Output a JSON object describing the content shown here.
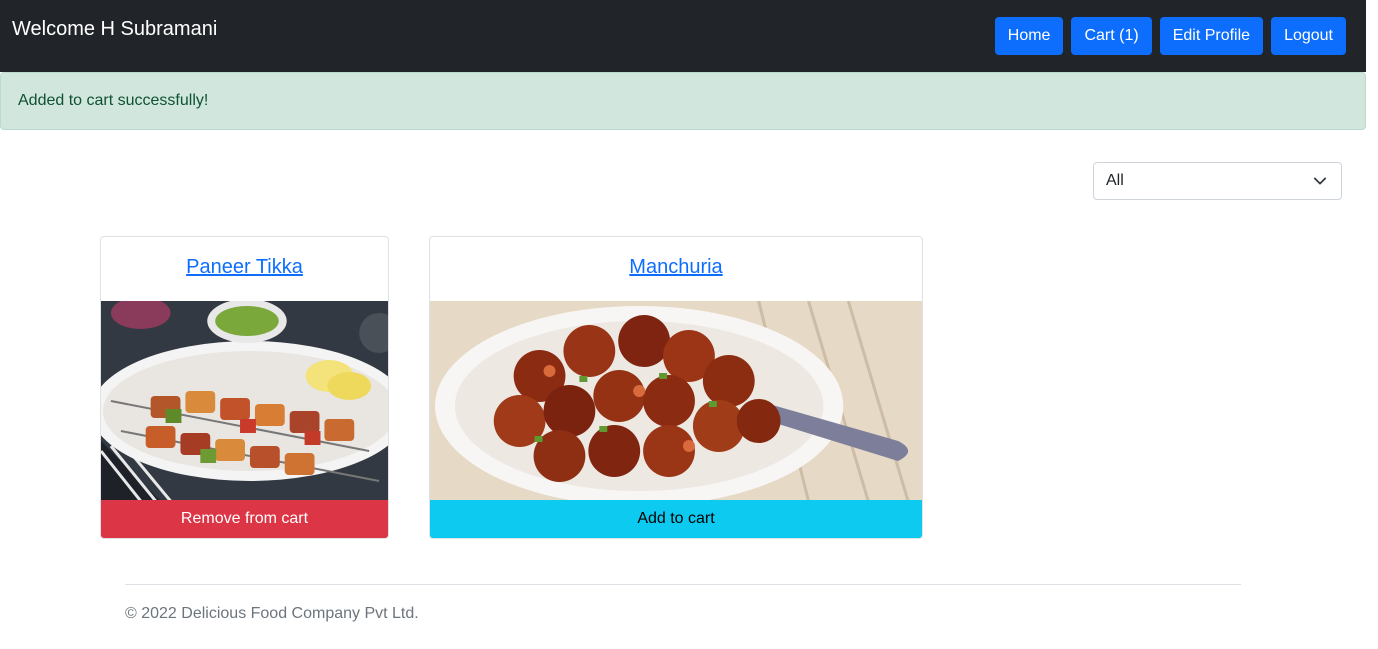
{
  "header": {
    "welcome": "Welcome H Subramani",
    "nav": {
      "home": "Home",
      "cart": "Cart (1)",
      "edit_profile": "Edit Profile",
      "logout": "Logout"
    }
  },
  "alert": {
    "message": "Added to cart successfully!"
  },
  "filter": {
    "selected": "All"
  },
  "products": [
    {
      "name": "Paneer Tikka",
      "action": "Remove from cart"
    },
    {
      "name": "Manchuria",
      "action": "Add to cart"
    }
  ],
  "footer": {
    "copyright": "© 2022 Delicious Food Company Pvt Ltd."
  },
  "colors": {
    "navbar": "#212529",
    "primary": "#0d6efd",
    "success_bg": "#d1e7dd",
    "danger": "#dc3545",
    "info": "#0dcaf0"
  }
}
